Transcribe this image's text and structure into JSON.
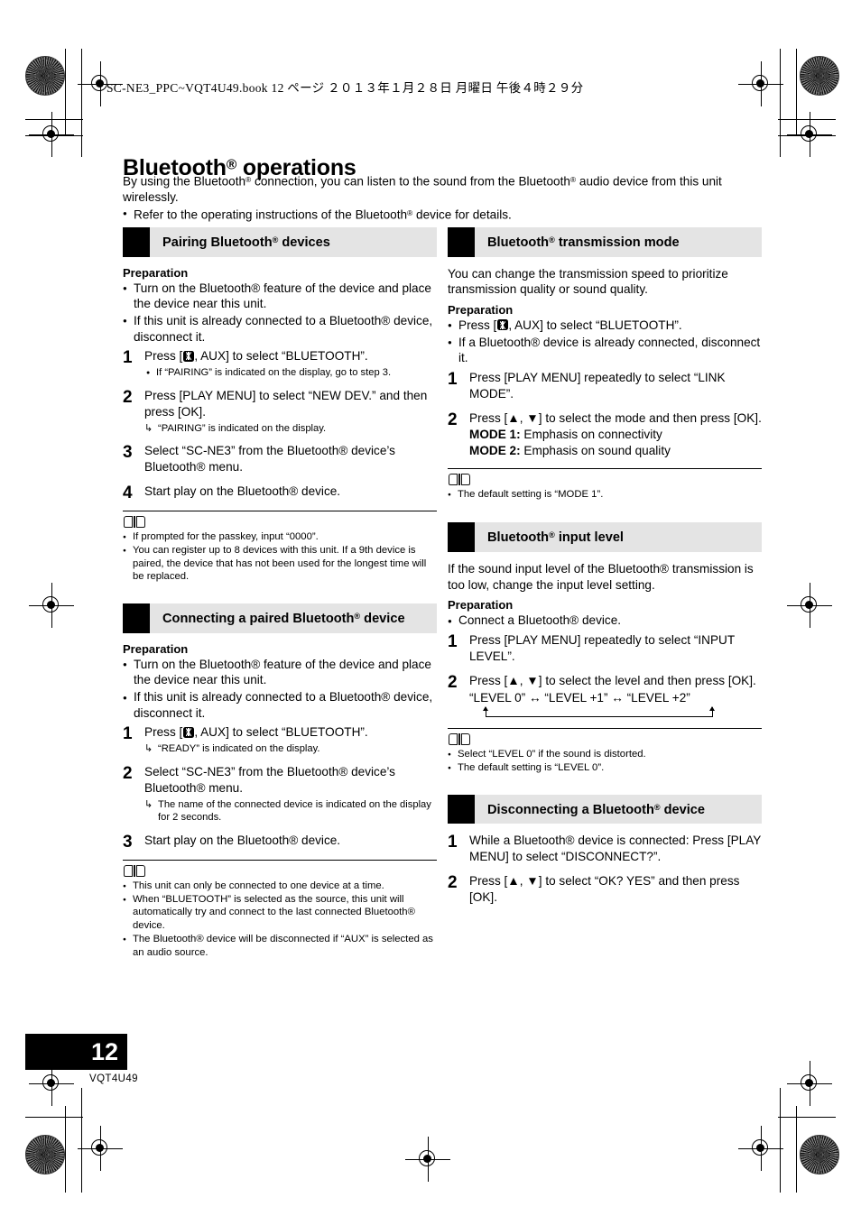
{
  "header": {
    "file_line": "SC-NE3_PPC~VQT4U49.book   12 ページ   ２０１３年１月２８日   月曜日   午後４時２９分"
  },
  "page": {
    "title_main": "Bluetooth",
    "title_rest": " operations",
    "intro_paragraph_a": "By using the Bluetooth",
    "intro_paragraph_b": " connection, you can listen to the sound from the Bluetooth",
    "intro_paragraph_c": " audio device from this unit wirelessly.",
    "intro_bullet_a": "Refer to the operating instructions of the Bluetooth",
    "intro_bullet_b": " device for details.",
    "page_number": "12",
    "doc_number": "VQT4U49"
  },
  "sections": {
    "pairing": {
      "heading_a": "Pairing Bluetooth",
      "heading_b": " devices",
      "prep_label": "Preparation",
      "prep_items": [
        "Turn on the Bluetooth® feature of the device and place the device near this unit.",
        "If this unit is already connected to a Bluetooth® device, disconnect it."
      ],
      "step1_num": "1",
      "step1_a": "Press [",
      "step1_b": ", AUX] to select “BLUETOOTH”.",
      "step1_sub": "If “PAIRING” is indicated on the display, go to step 3.",
      "step2_num": "2",
      "step2_text": "Press [PLAY MENU] to select “NEW DEV.” and then press [OK].",
      "step2_sub": "“PAIRING” is indicated on the display.",
      "step3_num": "3",
      "step3_text": "Select “SC-NE3” from the Bluetooth® device’s Bluetooth® menu.",
      "step4_num": "4",
      "step4_text": "Start play on the Bluetooth® device.",
      "notes": [
        "If prompted for the passkey, input “0000”.",
        "You can register up to 8 devices with this unit. If a 9th device is paired, the device that has not been used for the longest time will be replaced."
      ]
    },
    "connecting": {
      "heading_a": "Connecting a paired Bluetooth",
      "heading_b": " device",
      "prep_label": "Preparation",
      "prep_items": [
        "Turn on the Bluetooth® feature of the device and place the device near this unit.",
        "If this unit is already connected to a Bluetooth® device, disconnect it."
      ],
      "step1_num": "1",
      "step1_a": "Press [",
      "step1_b": ", AUX] to select “BLUETOOTH”.",
      "step1_sub": "“READY” is indicated on the display.",
      "step2_num": "2",
      "step2_text": "Select “SC-NE3” from the Bluetooth® device’s Bluetooth® menu.",
      "step2_sub": "The name of the connected device is indicated on the display for 2 seconds.",
      "step3_num": "3",
      "step3_text": "Start play on the Bluetooth® device.",
      "notes": [
        "This unit can only be connected to one device at a time.",
        "When “BLUETOOTH” is selected as the source, this unit will automatically try and connect to the last connected Bluetooth® device.",
        "The Bluetooth® device will be disconnected if “AUX” is selected as an audio source."
      ]
    },
    "transmission": {
      "heading_a": "Bluetooth",
      "heading_b": " transmission mode",
      "intro": "You can change the transmission speed to prioritize transmission quality or sound quality.",
      "prep_label": "Preparation",
      "prep_item1_a": "Press [",
      "prep_item1_b": ", AUX] to select “BLUETOOTH”.",
      "prep_item2": "If a Bluetooth® device is already connected, disconnect it.",
      "step1_num": "1",
      "step1_text": "Press [PLAY MENU] repeatedly to select “LINK MODE”.",
      "step2_num": "2",
      "step2_text": "Press [▲, ▼] to select the mode and then press [OK].",
      "mode1_label": "MODE 1:",
      "mode1_desc": " Emphasis on connectivity",
      "mode2_label": "MODE 2:",
      "mode2_desc": " Emphasis on sound quality",
      "notes": [
        "The default setting is “MODE 1”."
      ]
    },
    "input_level": {
      "heading_a": "Bluetooth",
      "heading_b": " input level",
      "intro": "If the sound input level of the Bluetooth® transmission is too low, change the input level setting.",
      "prep_label": "Preparation",
      "prep_items": [
        "Connect a Bluetooth® device."
      ],
      "step1_num": "1",
      "step1_text": "Press [PLAY MENU] repeatedly to select “INPUT LEVEL”.",
      "step2_num": "2",
      "step2_text": "Press [▲, ▼] to select the level and then press [OK].",
      "cycle_text": "“LEVEL 0” ↔ “LEVEL +1” ↔ “LEVEL +2”",
      "notes": [
        "Select “LEVEL 0” if the sound is distorted.",
        "The default setting is “LEVEL 0”."
      ]
    },
    "disconnecting": {
      "heading_a": "Disconnecting a Bluetooth",
      "heading_b": " device",
      "step1_num": "1",
      "step1_text": "While a Bluetooth® device is connected: Press [PLAY MENU] to select “DISCONNECT?”.",
      "step2_num": "2",
      "step2_text": "Press [▲, ▼] to select “OK? YES” and then press [OK]."
    }
  }
}
